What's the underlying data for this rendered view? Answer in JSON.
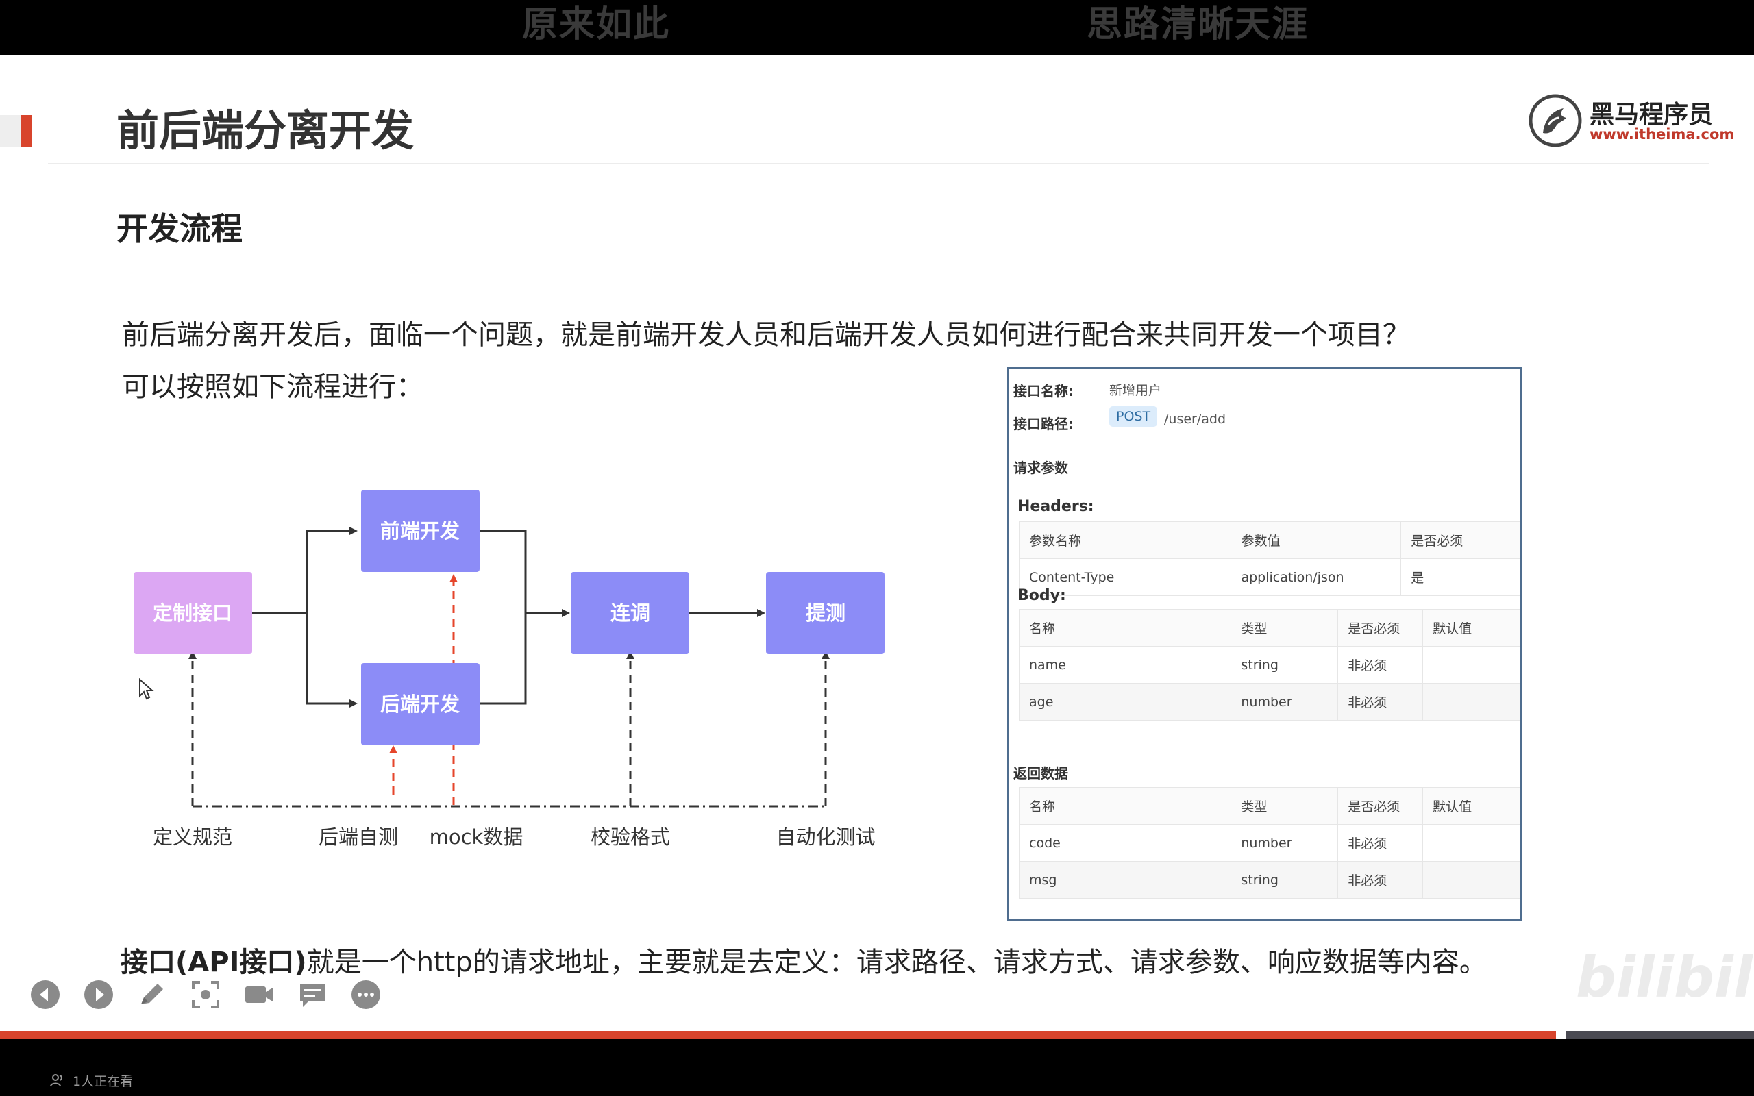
{
  "top_captions": {
    "left": "原来如此",
    "right": "思路清晰天涯"
  },
  "slide": {
    "title": "前后端分离开发",
    "logo": {
      "name": "黑马程序员",
      "url": "www.itheima.com"
    },
    "section_title": "开发流程",
    "paragraph_1": "前后端分离开发后，面临一个问题，就是前端开发人员和后端开发人员如何进行配合来共同开发一个项目？",
    "paragraph_2": "可以按照如下流程进行：",
    "flow": {
      "nodes": {
        "define_api": "定制接口",
        "frontend_dev": "前端开发",
        "backend_dev": "后端开发",
        "integration": "连调",
        "test_submit": "提测"
      },
      "bottom_labels": {
        "spec": "定义规范",
        "self_test": "后端自测",
        "mock": "mock数据",
        "validate": "校验格式",
        "auto_test": "自动化测试"
      }
    },
    "api_doc": {
      "name_label": "接口名称:",
      "name_value": "新增用户",
      "path_label": "接口路径:",
      "method": "POST",
      "path": "/user/add",
      "request_params_label": "请求参数",
      "headers_label": "Headers:",
      "headers_table": {
        "columns": [
          "参数名称",
          "参数值",
          "是否必须"
        ],
        "rows": [
          [
            "Content-Type",
            "application/json",
            "是"
          ]
        ]
      },
      "body_label": "Body:",
      "body_table": {
        "columns": [
          "名称",
          "类型",
          "是否必须",
          "默认值"
        ],
        "rows": [
          [
            "name",
            "string",
            "非必须",
            ""
          ],
          [
            "age",
            "number",
            "非必须",
            ""
          ]
        ]
      },
      "response_label": "返回数据",
      "response_table": {
        "columns": [
          "名称",
          "类型",
          "是否必须",
          "默认值"
        ],
        "rows": [
          [
            "code",
            "number",
            "非必须",
            ""
          ],
          [
            "msg",
            "string",
            "非必须",
            ""
          ]
        ]
      }
    },
    "bottom_text_bold": "接口(API接口)",
    "bottom_text_rest": "就是一个http的请求地址，主要就是去定义：请求路径、请求方式、请求参数、响应数据等内容。"
  },
  "player": {
    "toolbar_icons": [
      "prev-icon",
      "next-icon",
      "pen-icon",
      "screenshot-icon",
      "camera-icon",
      "danmaku-icon",
      "more-icon"
    ],
    "watermark": "bilibili",
    "progress_fraction": 0.887,
    "viewers_text": "1人正在看",
    "colors": {
      "accent": "#d8442c",
      "node_purple": "#8c8cf7",
      "node_pink": "#dca7f3"
    }
  }
}
